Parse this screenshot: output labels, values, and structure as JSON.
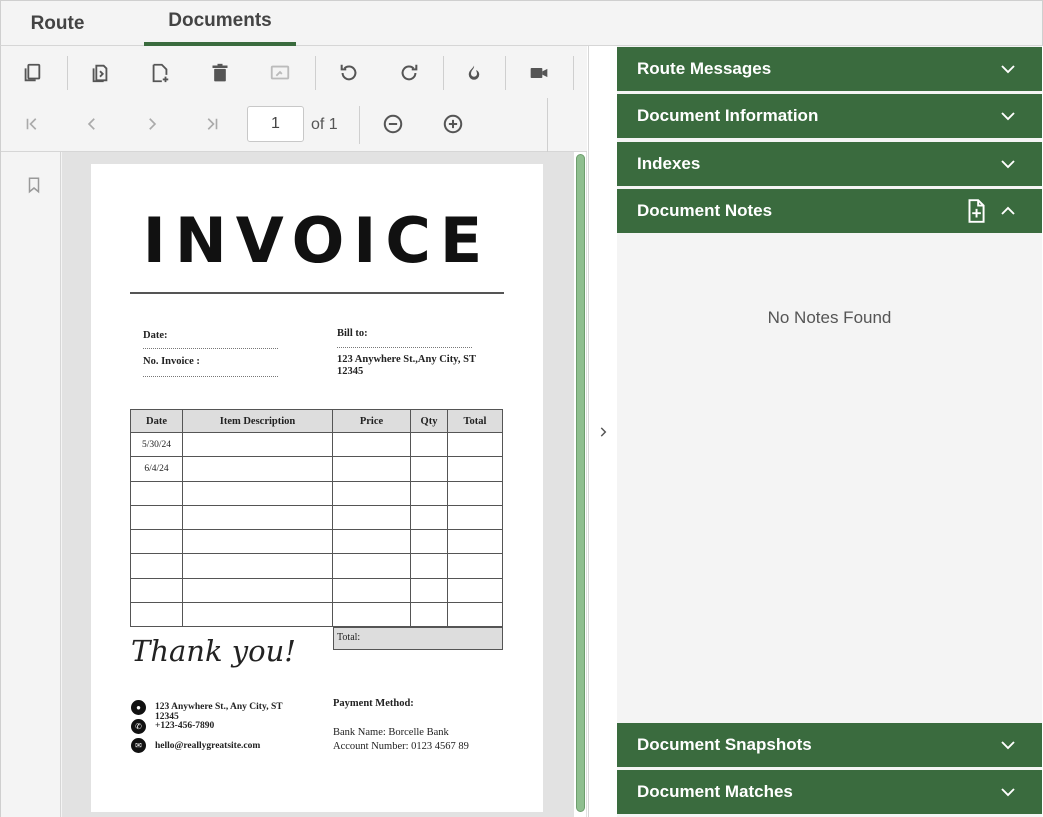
{
  "tabs": {
    "route": "Route",
    "documents": "Documents"
  },
  "toolbar": {
    "page_value": "1",
    "page_of": "of 1"
  },
  "document": {
    "title": "INVOICE",
    "date_label": "Date:",
    "invoice_no_label": "No. Invoice :",
    "bill_to_label": "Bill to:",
    "bill_to_address": "123 Anywhere St.,Any City, ST 12345",
    "table_headers": [
      "Date",
      "Item Description",
      "Price",
      "Qty",
      "Total"
    ],
    "table_rows": [
      [
        "5/30/24",
        "",
        "",
        "",
        ""
      ],
      [
        "6/4/24",
        "",
        "",
        "",
        ""
      ],
      [
        "",
        "",
        "",
        "",
        ""
      ],
      [
        "",
        "",
        "",
        "",
        ""
      ],
      [
        "",
        "",
        "",
        "",
        ""
      ],
      [
        "",
        "",
        "",
        "",
        ""
      ],
      [
        "",
        "",
        "",
        "",
        ""
      ],
      [
        "",
        "",
        "",
        "",
        ""
      ]
    ],
    "total_label": "Total:",
    "thank_you": "Thank you!",
    "contact_address": "123 Anywhere St., Any City, ST 12345",
    "contact_phone": "+123-456-7890",
    "contact_email": "hello@reallygreatsite.com",
    "payment_method_label": "Payment Method:",
    "bank_name": "Bank Name: Borcelle Bank",
    "account_number": "Account Number: 0123 4567 89"
  },
  "panel": {
    "route_messages": "Route Messages",
    "document_information": "Document Information",
    "indexes": "Indexes",
    "document_notes": "Document Notes",
    "no_notes": "No Notes Found",
    "document_snapshots": "Document Snapshots",
    "document_matches": "Document Matches"
  },
  "colors": {
    "accent_green": "#3a6b3e",
    "scroll_thumb": "#8fbf8f"
  }
}
